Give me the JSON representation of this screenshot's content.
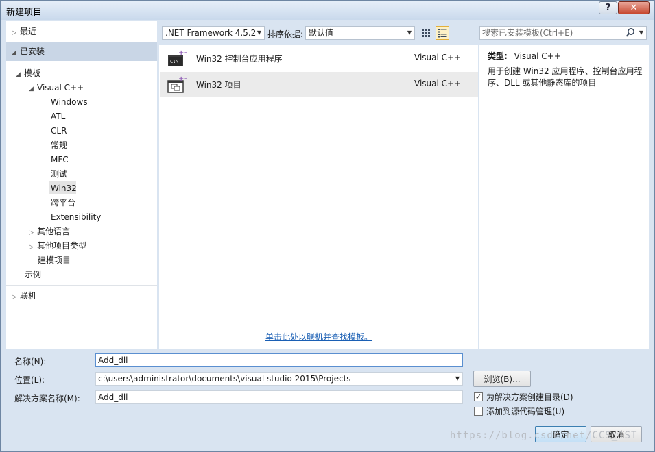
{
  "window": {
    "title": "新建项目",
    "help_label": "?",
    "close_label": "✕"
  },
  "tree": {
    "recent": "最近",
    "installed": "已安装",
    "templates": "模板",
    "visual_cpp": "Visual C++",
    "windows": "Windows",
    "atl": "ATL",
    "clr": "CLR",
    "general": "常规",
    "mfc": "MFC",
    "test": "测试",
    "win32": "Win32",
    "cross_platform": "跨平台",
    "extensibility": "Extensibility",
    "other_languages": "其他语言",
    "other_project_types": "其他项目类型",
    "modeling_projects": "建模项目",
    "samples": "示例",
    "online": "联机"
  },
  "toolbar": {
    "framework": ".NET Framework 4.5.2",
    "sort_label": "排序依据:",
    "sort_value": "默认值",
    "search_placeholder": "搜索已安装模板(Ctrl+E)"
  },
  "templates": [
    {
      "name": "Win32 控制台应用程序",
      "language": "Visual C++",
      "icon": "console-app-icon",
      "icon_text": "C:\\"
    },
    {
      "name": "Win32 项目",
      "language": "Visual C++",
      "icon": "win32-project-icon"
    }
  ],
  "online_link": "单击此处以联机并查找模板。",
  "info": {
    "type_label": "类型:",
    "type_value": "Visual C++",
    "description": "用于创建 Win32 应用程序、控制台应用程序、DLL 或其他静态库的项目"
  },
  "form": {
    "name_label": "名称(N):",
    "name_value": "Add_dll",
    "location_label": "位置(L):",
    "location_value": "c:\\users\\administrator\\documents\\visual studio 2015\\Projects",
    "solution_label": "解决方案名称(M):",
    "solution_value": "Add_dll",
    "browse_label": "浏览(B)...",
    "create_dir_label": "为解决方案创建目录(D)",
    "create_dir_checked": true,
    "add_source_control_label": "添加到源代码管理(U)",
    "add_source_control_checked": false,
    "ok_label": "确定",
    "cancel_label": "取消"
  },
  "watermark": "https://blog.csdn.net/CCS_1ST"
}
